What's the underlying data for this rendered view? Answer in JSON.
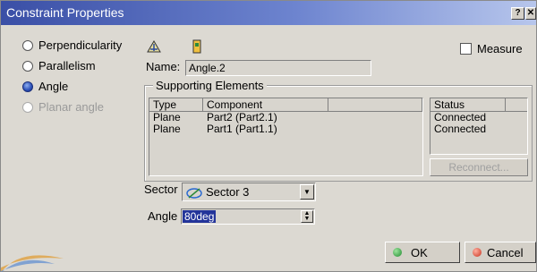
{
  "window": {
    "title": "Constraint Properties",
    "help_glyph": "?",
    "close_glyph": "✕"
  },
  "constraint_types": [
    {
      "label": "Perpendicularity",
      "checked": false,
      "enabled": true
    },
    {
      "label": "Parallelism",
      "checked": false,
      "enabled": true
    },
    {
      "label": "Angle",
      "checked": true,
      "enabled": true
    },
    {
      "label": "Planar angle",
      "checked": false,
      "enabled": false
    }
  ],
  "toolbar_icons": [
    "constraint-axis-icon",
    "part-icon"
  ],
  "measure": {
    "label": "Measure",
    "checked": false
  },
  "name": {
    "label": "Name:",
    "value": "Angle.2"
  },
  "supporting_elements": {
    "legend": "Supporting Elements",
    "columns": [
      "Type",
      "Component"
    ],
    "rows": [
      {
        "type": "Plane",
        "component": "Part2 (Part2.1)"
      },
      {
        "type": "Plane",
        "component": "Part1 (Part1.1)"
      }
    ],
    "status_header": "Status",
    "statuses": [
      "Connected",
      "Connected"
    ],
    "reconnect_label": "Reconnect..."
  },
  "sector": {
    "label": "Sector",
    "value": "Sector 3"
  },
  "angle": {
    "label": "Angle",
    "value": "80deg"
  },
  "buttons": {
    "ok": "OK",
    "cancel": "Cancel"
  },
  "colors": {
    "title_start": "#3a4fa6",
    "selection": "#23349a",
    "ok_dot": "#1e8a2e",
    "cancel_dot": "#c8321e"
  }
}
